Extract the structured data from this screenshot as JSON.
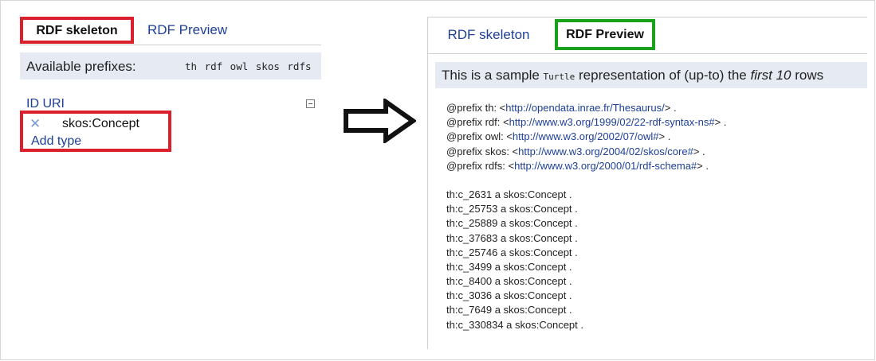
{
  "left_panel": {
    "tabs": [
      {
        "label": "RDF skeleton",
        "active": true,
        "highlight": "#d9202c"
      },
      {
        "label": "RDF Preview",
        "active": false
      }
    ],
    "prefix_label": "Available prefixes:",
    "prefixes": "th rdf owl skos rdfs",
    "id_uri_label": "ID URI",
    "type_value": "skos:Concept",
    "add_type_label": "Add type",
    "remove_icon": "x-icon",
    "collapse_icon": "collapse-minus-icon"
  },
  "arrow_icon": "right-arrow-icon",
  "right_panel": {
    "tabs": [
      {
        "label": "RDF skeleton",
        "active": false
      },
      {
        "label": "RDF Preview",
        "active": true,
        "highlight": "#1aa11b"
      }
    ],
    "info": {
      "part1": "This is a sample ",
      "format": "Turtle",
      "part2": " representation of (up-to) the ",
      "emph": "first 10",
      "part3": " rows"
    },
    "prefix_lines": [
      {
        "prefix": "@prefix th: <",
        "url": "http://opendata.inrae.fr/Thesaurus/",
        "suffix": "> ."
      },
      {
        "prefix": "@prefix rdf: <",
        "url": "http://www.w3.org/1999/02/22-rdf-syntax-ns#",
        "suffix": "> ."
      },
      {
        "prefix": "@prefix owl: <",
        "url": "http://www.w3.org/2002/07/owl#",
        "suffix": "> ."
      },
      {
        "prefix": "@prefix skos: <",
        "url": "http://www.w3.org/2004/02/skos/core#",
        "suffix": "> ."
      },
      {
        "prefix": "@prefix rdfs: <",
        "url": "http://www.w3.org/2000/01/rdf-schema#",
        "suffix": "> ."
      }
    ],
    "triples": [
      "th:c_2631 a skos:Concept .",
      "th:c_25753 a skos:Concept .",
      "th:c_25889 a skos:Concept .",
      "th:c_37683 a skos:Concept .",
      "th:c_25746 a skos:Concept .",
      "th:c_3499 a skos:Concept .",
      "th:c_8400 a skos:Concept .",
      "th:c_3036 a skos:Concept .",
      "th:c_7649 a skos:Concept .",
      "th:c_330834 a skos:Concept ."
    ]
  }
}
